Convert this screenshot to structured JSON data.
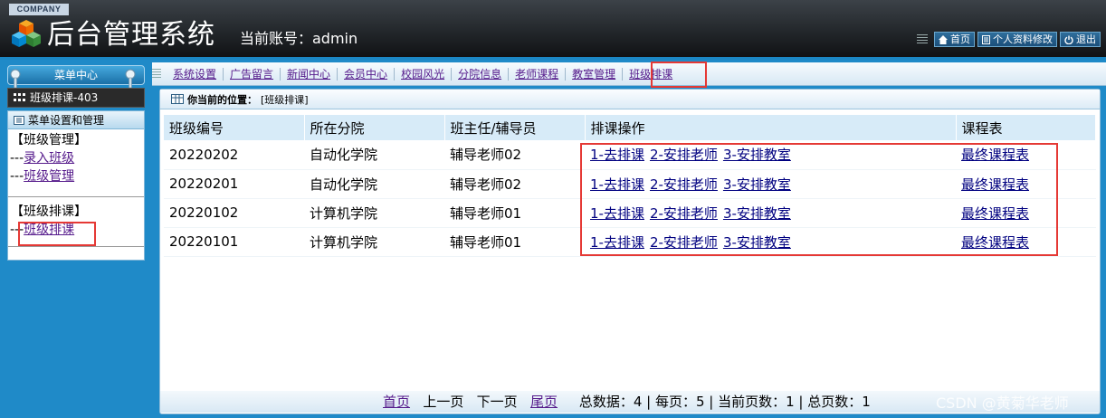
{
  "header": {
    "company": "COMPANY",
    "title": "后台管理系统",
    "account": "当前账号：admin",
    "links": [
      {
        "label": "首页",
        "icon": "home-icon"
      },
      {
        "label": "个人资料修改",
        "icon": "document-icon"
      },
      {
        "label": "退出",
        "icon": "power-icon"
      }
    ]
  },
  "sidebar": {
    "menu_center": "菜单中心",
    "current": "班级排课-403",
    "section_title": "菜单设置和管理",
    "groups": [
      {
        "title": "【班级管理】",
        "items": [
          "录入班级",
          "班级管理"
        ]
      },
      {
        "title": "【班级排课】",
        "items": [
          "班级排课"
        ]
      }
    ],
    "item_prefix": "---"
  },
  "nav": {
    "items": [
      "系统设置",
      "广告留言",
      "新闻中心",
      "会员中心",
      "校园风光",
      "分院信息",
      "老师课程",
      "教室管理",
      "班级排课"
    ]
  },
  "breadcrumb": {
    "label": "你当前的位置：",
    "value": "[班级排课]"
  },
  "table": {
    "headers": [
      "班级编号",
      "所在分院",
      "班主任/辅导员",
      "排课操作",
      "课程表"
    ],
    "actions": [
      "1-去排课",
      "2-安排老师",
      "3-安排教室"
    ],
    "schedule_link": "最终课程表",
    "rows": [
      {
        "id": "20220202",
        "college": "自动化学院",
        "teacher": "辅导老师02"
      },
      {
        "id": "20220201",
        "college": "自动化学院",
        "teacher": "辅导老师02"
      },
      {
        "id": "20220102",
        "college": "计算机学院",
        "teacher": "辅导老师01"
      },
      {
        "id": "20220101",
        "college": "计算机学院",
        "teacher": "辅导老师01"
      }
    ]
  },
  "pager": {
    "first": "首页",
    "prev": "上一页",
    "next": "下一页",
    "last": "尾页",
    "summary": "总数据：4 | 每页：5 | 当前页数：1 | 总页数：1"
  },
  "watermark": "CSDN @黄菊华老师",
  "colors": {
    "accent": "#1f8ac8",
    "highlight": "#e53935",
    "header_bg": "#23272b"
  }
}
